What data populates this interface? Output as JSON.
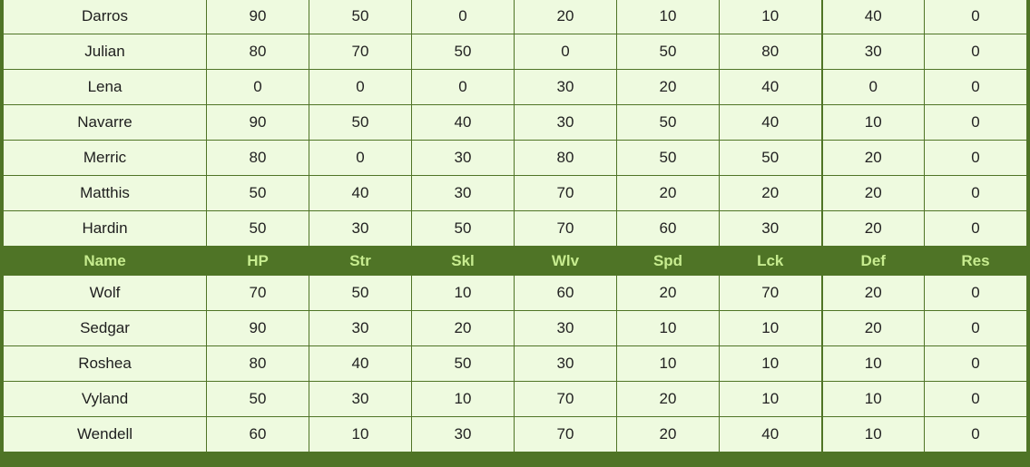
{
  "colors": {
    "header_bg": "#4f7426",
    "header_text": "#c7ec8f",
    "cell_bg": "#eefadf",
    "border": "#4f7426"
  },
  "header": {
    "columns": [
      "Name",
      "HP",
      "Str",
      "Skl",
      "Wlv",
      "Spd",
      "Lck",
      "Def",
      "Res"
    ]
  },
  "rows_top": [
    {
      "name": "Darros",
      "values": [
        "90",
        "50",
        "0",
        "20",
        "10",
        "10",
        "40",
        "0"
      ]
    },
    {
      "name": "Julian",
      "values": [
        "80",
        "70",
        "50",
        "0",
        "50",
        "80",
        "30",
        "0"
      ]
    },
    {
      "name": "Lena",
      "values": [
        "0",
        "0",
        "0",
        "30",
        "20",
        "40",
        "0",
        "0"
      ]
    },
    {
      "name": "Navarre",
      "values": [
        "90",
        "50",
        "40",
        "30",
        "50",
        "40",
        "10",
        "0"
      ]
    },
    {
      "name": "Merric",
      "values": [
        "80",
        "0",
        "30",
        "80",
        "50",
        "50",
        "20",
        "0"
      ]
    },
    {
      "name": "Matthis",
      "values": [
        "50",
        "40",
        "30",
        "70",
        "20",
        "20",
        "20",
        "0"
      ]
    },
    {
      "name": "Hardin",
      "values": [
        "50",
        "30",
        "50",
        "70",
        "60",
        "30",
        "20",
        "0"
      ]
    }
  ],
  "rows_bottom": [
    {
      "name": "Wolf",
      "values": [
        "70",
        "50",
        "10",
        "60",
        "20",
        "70",
        "20",
        "0"
      ]
    },
    {
      "name": "Sedgar",
      "values": [
        "90",
        "30",
        "20",
        "30",
        "10",
        "10",
        "20",
        "0"
      ]
    },
    {
      "name": "Roshea",
      "values": [
        "80",
        "40",
        "50",
        "30",
        "10",
        "10",
        "10",
        "0"
      ]
    },
    {
      "name": "Vyland",
      "values": [
        "50",
        "30",
        "10",
        "70",
        "20",
        "10",
        "10",
        "0"
      ]
    },
    {
      "name": "Wendell",
      "values": [
        "60",
        "10",
        "30",
        "70",
        "20",
        "40",
        "10",
        "0"
      ]
    }
  ]
}
